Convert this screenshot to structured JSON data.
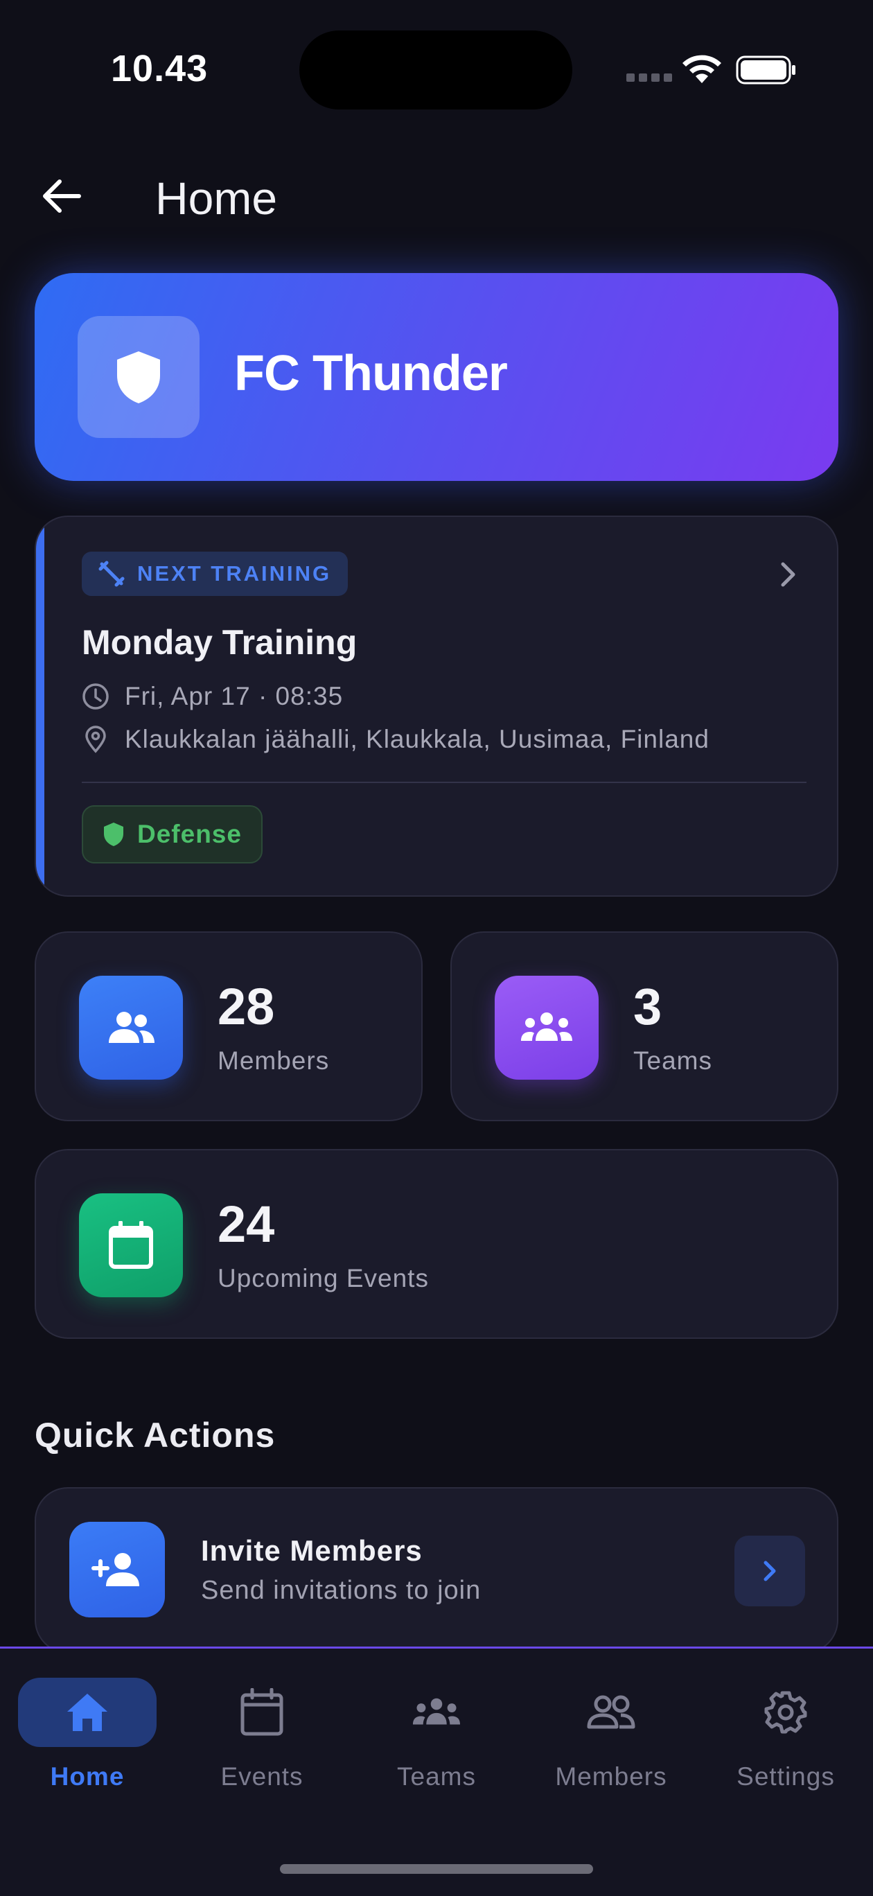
{
  "status_bar": {
    "time": "10.43"
  },
  "header": {
    "title": "Home"
  },
  "club": {
    "name": "FC Thunder"
  },
  "next_training": {
    "badge": "NEXT TRAINING",
    "title": "Monday Training",
    "datetime": "Fri, Apr 17 · 08:35",
    "location": "Klaukkalan jäähalli, Klaukkala, Uusimaa, Finland",
    "position_tag": "Defense"
  },
  "stats": {
    "members": {
      "value": "28",
      "label": "Members",
      "color": "#3a78f4"
    },
    "teams": {
      "value": "3",
      "label": "Teams",
      "color": "#8b4ff2"
    },
    "events": {
      "value": "24",
      "label": "Upcoming Events",
      "color": "#14b277"
    }
  },
  "quick_actions": {
    "title": "Quick Actions",
    "items": [
      {
        "title": "Invite Members",
        "subtitle": "Send invitations to join",
        "icon": "person-add-icon"
      }
    ]
  },
  "nav": {
    "items": [
      {
        "label": "Home",
        "icon": "home-icon",
        "active": true
      },
      {
        "label": "Events",
        "icon": "calendar-icon",
        "active": false
      },
      {
        "label": "Teams",
        "icon": "groups-icon",
        "active": false
      },
      {
        "label": "Members",
        "icon": "people-icon",
        "active": false
      },
      {
        "label": "Settings",
        "icon": "gear-icon",
        "active": false
      }
    ]
  },
  "colors": {
    "accent": "#3f7af5",
    "background": "#0f0f18",
    "card": "#1b1b2b",
    "success": "#4cbf6a"
  }
}
